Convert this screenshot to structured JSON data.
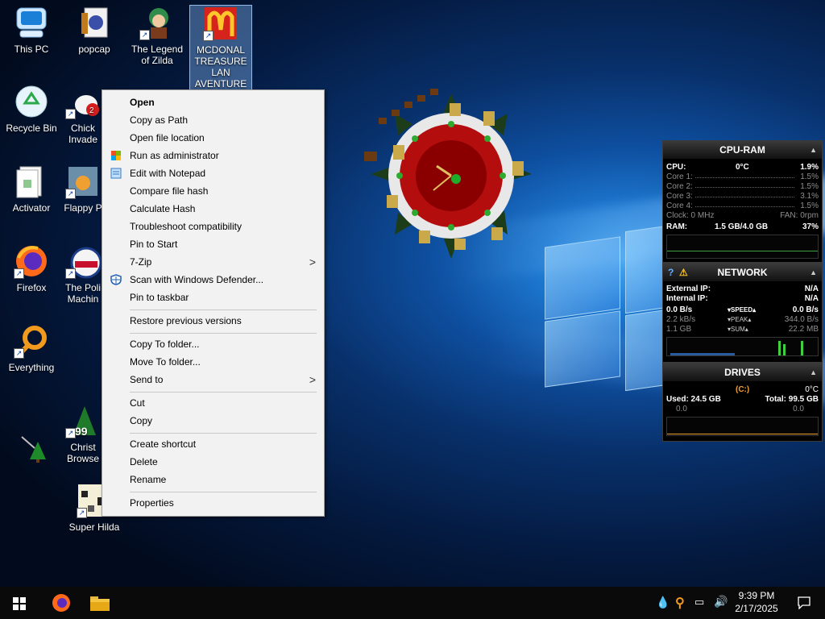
{
  "desktop": {
    "icons": [
      {
        "label": "This PC"
      },
      {
        "label": "popcap"
      },
      {
        "label": "The Legend of Zilda"
      },
      {
        "label": "MCDONAL TREASURE LAN AVENTURE"
      },
      {
        "label": "Recycle Bin"
      },
      {
        "label": "Chick Invade"
      },
      {
        "label": "Activator"
      },
      {
        "label": "Flappy P"
      },
      {
        "label": "Firefox"
      },
      {
        "label": "The Poli Machin"
      },
      {
        "label": "Everything"
      },
      {
        "label": "Christ Browse"
      },
      {
        "label": "Super Hilda"
      }
    ]
  },
  "context_menu": {
    "items": [
      {
        "label": "Open"
      },
      {
        "label": "Copy as Path"
      },
      {
        "label": "Open file location"
      },
      {
        "label": "Run as administrator"
      },
      {
        "label": "Edit with Notepad"
      },
      {
        "label": "Compare file hash"
      },
      {
        "label": "Calculate Hash"
      },
      {
        "label": "Troubleshoot compatibility"
      },
      {
        "label": "Pin to Start"
      },
      {
        "label": "7-Zip"
      },
      {
        "label": "Scan with Windows Defender..."
      },
      {
        "label": "Pin to taskbar"
      },
      {
        "label": "Restore previous versions"
      },
      {
        "label": "Copy To folder..."
      },
      {
        "label": "Move To folder..."
      },
      {
        "label": "Send to"
      },
      {
        "label": "Cut"
      },
      {
        "label": "Copy"
      },
      {
        "label": "Create shortcut"
      },
      {
        "label": "Delete"
      },
      {
        "label": "Rename"
      },
      {
        "label": "Properties"
      }
    ],
    "submenu_arrow": ">"
  },
  "cpu_ram": {
    "title": "CPU-RAM",
    "cpu_label": "CPU:",
    "cpu_temp": "0°C",
    "cpu_pct": "1.9%",
    "cores": [
      {
        "label": "Core 1:",
        "value": "1.5%"
      },
      {
        "label": "Core 2:",
        "value": "1.5%"
      },
      {
        "label": "Core 3:",
        "value": "3.1%"
      },
      {
        "label": "Core 4:",
        "value": "1.5%"
      }
    ],
    "clock": "Clock: 0 MHz",
    "fan": "FAN: 0rpm",
    "ram_label": "RAM:",
    "ram_used": "1.5 GB/4.0 GB",
    "ram_pct": "37%"
  },
  "network": {
    "title": "NETWORK",
    "ext_label": "External IP:",
    "ext_value": "N/A",
    "int_label": "Internal IP:",
    "int_value": "N/A",
    "rows": [
      {
        "left": "0.0 B/s",
        "mid": "SPEED",
        "right": "0.0 B/s"
      },
      {
        "left": "2.2 kB/s",
        "mid": "PEAK",
        "right": "344.0 B/s"
      },
      {
        "left": "1.1 GB",
        "mid": "SUM",
        "right": "22.2 MB"
      }
    ]
  },
  "drives": {
    "title": "DRIVES",
    "drive": "(C:)",
    "temp": "0°C",
    "used": "Used: 24.5 GB",
    "total": "Total: 99.5 GB",
    "read": "0.0",
    "write": "0.0"
  },
  "taskbar": {
    "time": "9:39 PM",
    "date": "2/17/2025"
  },
  "colors": {
    "accent_orange": "#f0a030",
    "menu_bg": "#f2f2f2"
  }
}
